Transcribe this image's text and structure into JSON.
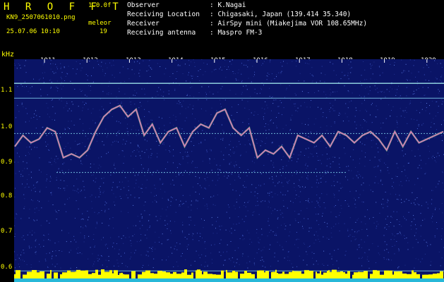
{
  "header": {
    "title": "H R O F F T",
    "version": "1.0.0f",
    "filename": "KN9_2507061010.png",
    "datetime": "25.07.06 10:10",
    "meteor_label": "meleor",
    "meteor_count": "19",
    "info": [
      {
        "key": "Observer",
        "value": ": K.Nagai"
      },
      {
        "key": "Receiving Location",
        "value": ": Chigasaki, Japan (139.414 35.340)"
      },
      {
        "key": "Receiver",
        "value": ": AirSpy mini (Miakejima VOR 108.65MHz)"
      },
      {
        "key": "Receiving antenna",
        "value": ": Maspro FM-3"
      }
    ]
  },
  "yaxis_unit": "kHz",
  "yaxis_ticks": [
    "1.1",
    "1.0",
    "0.9",
    "0.8",
    "0.7",
    "0.6"
  ],
  "xaxis_ticks": [
    "1011",
    "1012",
    "1013",
    "1014",
    "1015",
    "1016",
    "1017",
    "1018",
    "1019",
    "1020"
  ],
  "colors": {
    "background": "#0a1466",
    "header_text": "#ffff00",
    "info_text": "#ffffff",
    "trace": "#e070c0",
    "stripe": "#ffff00"
  },
  "chart_data": {
    "type": "heatmap",
    "title": "",
    "xlabel": "",
    "ylabel": "kHz",
    "x_ticks": [
      "1011",
      "1012",
      "1013",
      "1014",
      "1015",
      "1016",
      "1017",
      "1018",
      "1019",
      "1020"
    ],
    "ylim": [
      0.585,
      1.185
    ],
    "carrier_lines_khz": [
      1.12,
      1.08,
      0.985,
      0.88,
      0.615
    ],
    "trace_khz": [
      0.95,
      0.98,
      0.96,
      0.97,
      1.0,
      0.99,
      0.92,
      0.93,
      0.92,
      0.94,
      0.99,
      1.03,
      1.05,
      1.06,
      1.03,
      1.05,
      0.98,
      1.01,
      0.96,
      0.99,
      1.0,
      0.95,
      0.99,
      1.01,
      1.0,
      1.04,
      1.05,
      1.0,
      0.98,
      1.0,
      0.92,
      0.94,
      0.93,
      0.95,
      0.92,
      0.98,
      0.97,
      0.96,
      0.98,
      0.95,
      0.99,
      0.98,
      0.96,
      0.98,
      0.99,
      0.97,
      0.94,
      0.99,
      0.95,
      0.99,
      0.96,
      0.97,
      0.98,
      0.99
    ]
  }
}
